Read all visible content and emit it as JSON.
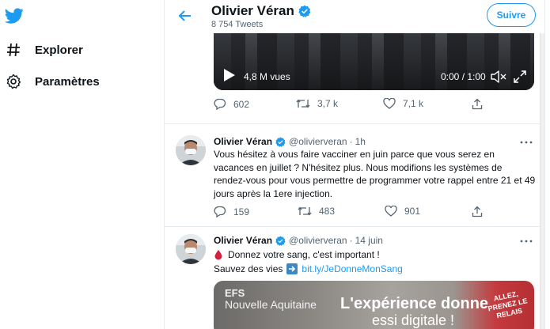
{
  "nav": {
    "items": [
      {
        "label": "Explorer",
        "icon": "hash-icon"
      },
      {
        "label": "Paramètres",
        "icon": "gear-icon"
      }
    ]
  },
  "header": {
    "name": "Olivier Véran",
    "tweet_count": "8 754 Tweets",
    "follow_label": "Suivre"
  },
  "video": {
    "views": "4,8 M vues",
    "time": "0:00 / 1:00"
  },
  "tweets": [
    {
      "name": "Olivier Véran",
      "handle": "@olivierveran",
      "date": "1h",
      "text": "Vous hésitez à vous faire vacciner en juin parce que vous serez en vacances en juillet ? N'hésitez plus. Nous modifions les systèmes de rendez-vous pour vous permettre de programmer votre rappel entre 21 et 49 jours après la 1ere injection.",
      "replies": "159",
      "retweets": "483",
      "likes": "901"
    },
    {
      "name": "Olivier Véran",
      "handle": "@olivierveran",
      "date": "14 juin",
      "line1": "Donnez votre sang, c'est important !",
      "line2": "Sauvez des vies",
      "link": "bit.ly/JeDonneMonSang",
      "image": {
        "t1": "EFS",
        "t2": "Nouvelle Aquitaine",
        "t3": "L'expérience donne",
        "t4": "essi digitale !",
        "badge": "ALLEZ, PRENEZ LE RELAIS"
      }
    }
  ],
  "top_tweet_actions": {
    "replies": "602",
    "retweets": "3,7 k",
    "likes": "7,1 k"
  },
  "colors": {
    "accent": "#1d9bf0",
    "text": "#0f1419",
    "muted": "#536471",
    "border": "#e6ecf0",
    "blood": "#d4213d"
  }
}
